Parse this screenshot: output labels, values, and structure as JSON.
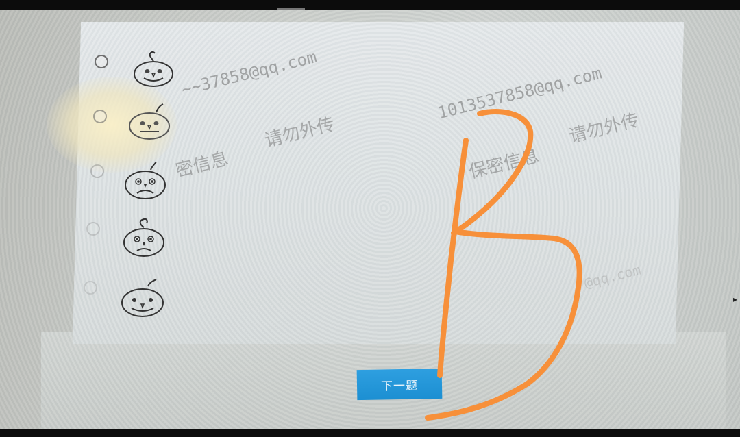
{
  "quiz": {
    "option_count": 5,
    "options": [
      {
        "face": "smile"
      },
      {
        "face": "smile"
      },
      {
        "face": "frown"
      },
      {
        "face": "frown"
      },
      {
        "face": "smile"
      }
    ],
    "next_button_label": "下一题"
  },
  "watermarks": {
    "email_partial": "~~37858@qq.com",
    "email_full": "1013537858@qq.com",
    "confidential_partial": "密信息",
    "confidential_right": "保密信息",
    "do_not_share": "请勿外传",
    "faint_email": "@qq.com"
  },
  "annotation": {
    "handwritten_letter": "B",
    "color": "#f7903a"
  },
  "colors": {
    "button_blue": "#1f93d6",
    "screen_bg": "#dde2e3"
  }
}
